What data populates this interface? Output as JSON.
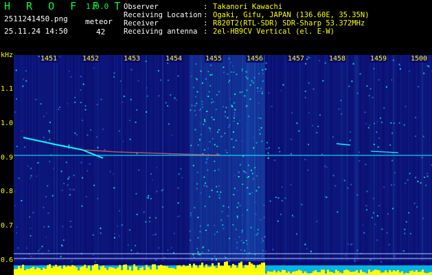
{
  "app": {
    "title_letters": "H R O F F T",
    "version": "1.0.0"
  },
  "file": {
    "name": "2511241450.png",
    "datetime": "25.11.24 14:50"
  },
  "meteor": {
    "label": "meteor",
    "count": "42"
  },
  "info": [
    {
      "key": "Observer",
      "value": "Takanori Kawachi"
    },
    {
      "key": "Receiving Location",
      "value": "Ogaki, Gifu, JAPAN (136.60E, 35.35N)"
    },
    {
      "key": "Receiver",
      "value": "R820T2(RTL-SDR) SDR-Sharp 53.372MHz"
    },
    {
      "key": "Receiving antenna",
      "value": "2el-HB9CV Vertical (el. E-W)"
    }
  ],
  "separator": ":",
  "axis": {
    "unit": "kHz",
    "y_ticks": [
      "1.1",
      "1.0",
      "0.9",
      "0.8",
      "0.7",
      "0.6"
    ],
    "x_ticks": [
      "1451",
      "1452",
      "1453",
      "1454",
      "1455",
      "1456",
      "1457",
      "1458",
      "1459",
      "1500"
    ]
  },
  "colors": {
    "text_green": "#00ff3c",
    "text_yellow": "#ffff00",
    "background_blue": "#0a0a6e",
    "echo_cyan": "#00ffff",
    "bottom_level": "#ffff00"
  }
}
